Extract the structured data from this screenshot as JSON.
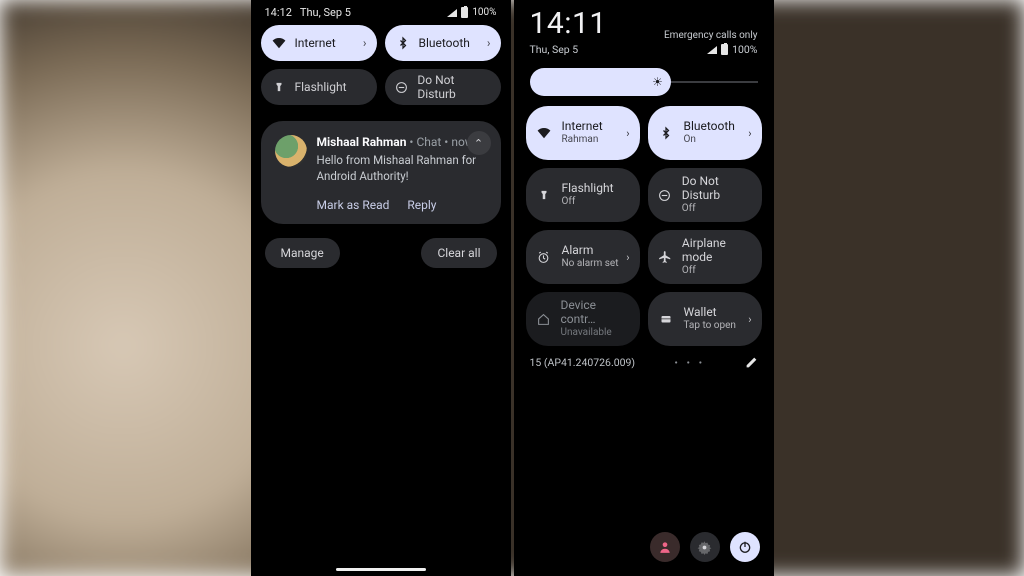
{
  "left": {
    "status": {
      "time": "14:12",
      "date": "Thu, Sep 5",
      "battery": "100%"
    },
    "quick": {
      "internet": "Internet",
      "bluetooth": "Bluetooth",
      "flashlight": "Flashlight",
      "dnd": "Do Not Disturb"
    },
    "notif": {
      "sender": "Mishaal Rahman",
      "meta": " • Chat • now",
      "message": "Hello from Mishaal Rahman for Android Authority!",
      "action1": "Mark as Read",
      "action2": "Reply"
    },
    "footer": {
      "manage": "Manage",
      "clear": "Clear all"
    }
  },
  "right": {
    "clock": "14:11",
    "emergency": "Emergency calls only",
    "date": "Thu, Sep 5",
    "battery": "100%",
    "tiles": {
      "internet": {
        "label": "Internet",
        "sub": "Rahman",
        "state": "active",
        "icon": "wifi",
        "chev": true
      },
      "bluetooth": {
        "label": "Bluetooth",
        "sub": "On",
        "state": "active",
        "icon": "bluetooth",
        "chev": true
      },
      "flashlight": {
        "label": "Flashlight",
        "sub": "Off",
        "state": "inactive",
        "icon": "flash",
        "chev": false
      },
      "dnd": {
        "label": "Do Not Disturb",
        "sub": "Off",
        "state": "inactive",
        "icon": "dnd",
        "chev": false
      },
      "alarm": {
        "label": "Alarm",
        "sub": "No alarm set",
        "state": "inactive",
        "icon": "alarm",
        "chev": true
      },
      "airplane": {
        "label": "Airplane mode",
        "sub": "Off",
        "state": "inactive",
        "icon": "airplane",
        "chev": false
      },
      "devicecontrols": {
        "label": "Device contr…",
        "sub": "Unavailable",
        "state": "dim",
        "icon": "home",
        "chev": false
      },
      "wallet": {
        "label": "Wallet",
        "sub": "Tap to open",
        "state": "inactive",
        "icon": "wallet",
        "chev": true
      }
    },
    "build": "15 (AP41.240726.009)"
  }
}
